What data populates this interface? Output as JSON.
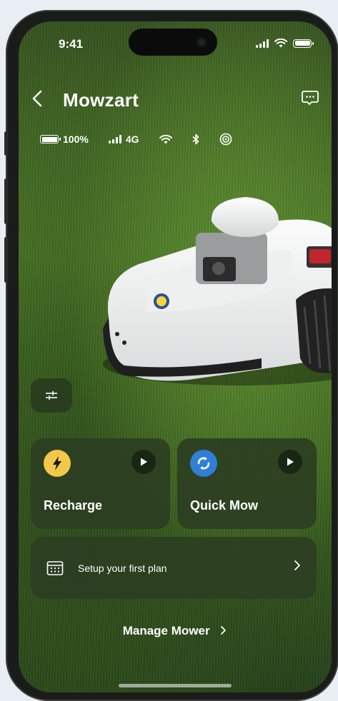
{
  "status_bar": {
    "time": "9:41"
  },
  "header": {
    "title": "Mowzart"
  },
  "device_info": {
    "battery": "100%",
    "network": "4G"
  },
  "actions": {
    "recharge": {
      "label": "Recharge",
      "icon": "lightning-icon",
      "icon_color": "#f2c84b"
    },
    "quick_mow": {
      "label": "Quick Mow",
      "icon": "quick-mow-icon",
      "icon_color": "#2f7fd6"
    }
  },
  "plan": {
    "label": "Setup your first plan"
  },
  "footer": {
    "manage_label": "Manage Mower"
  }
}
